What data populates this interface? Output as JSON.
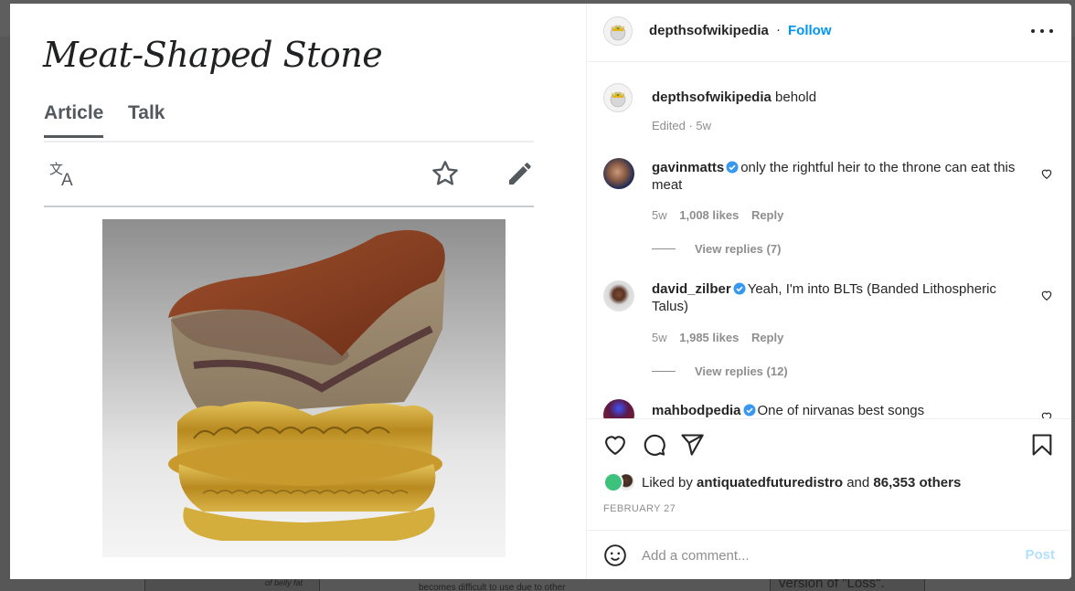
{
  "background": {
    "fragments": [
      "of belly fat",
      "becomes difficult to use due to other",
      "version of \"Loss\"."
    ]
  },
  "wiki": {
    "title": "Meat-Shaped Stone",
    "tabs": [
      {
        "label": "Article",
        "active": true
      },
      {
        "label": "Talk",
        "active": false
      }
    ],
    "toolbar": {
      "translate_icon": "translate-icon",
      "star_icon": "star-icon",
      "edit_icon": "pencil-icon"
    },
    "image_alt": "Meat-shaped stone on ornate gold stand"
  },
  "post": {
    "author": "depthsofwikipedia",
    "separator": "·",
    "follow_label": "Follow",
    "more_icon": "more-horizontal-icon",
    "caption": {
      "user": "depthsofwikipedia",
      "text": "behold",
      "meta": "Edited · 5w"
    },
    "comments": [
      {
        "user": "gavinmatts",
        "verified": true,
        "text": "only the rightful heir to the throne can eat this meat",
        "age": "5w",
        "likes": "1,008 likes",
        "reply_label": "Reply",
        "view_replies": "View replies (7)"
      },
      {
        "user": "david_zilber",
        "verified": true,
        "text": "Yeah, I'm into BLTs (Banded Lithospheric Talus)",
        "age": "5w",
        "likes": "1,985 likes",
        "reply_label": "Reply",
        "view_replies": "View replies (12)"
      },
      {
        "user": "mahbodpedia",
        "verified": true,
        "text": "One of nirvanas best songs"
      }
    ],
    "liked_by_prefix": "Liked by",
    "liked_by_user": "antiquatedfuturedistro",
    "liked_by_and": "and",
    "liked_by_others": "86,353 others",
    "date": "FEBRUARY 27",
    "add_comment_placeholder": "Add a comment...",
    "post_label": "Post"
  },
  "colors": {
    "follow": "#0095f6",
    "verified": "#3897f0",
    "post_disabled": "#b2dffc",
    "text": "#262626",
    "muted": "#8e8e8e"
  }
}
